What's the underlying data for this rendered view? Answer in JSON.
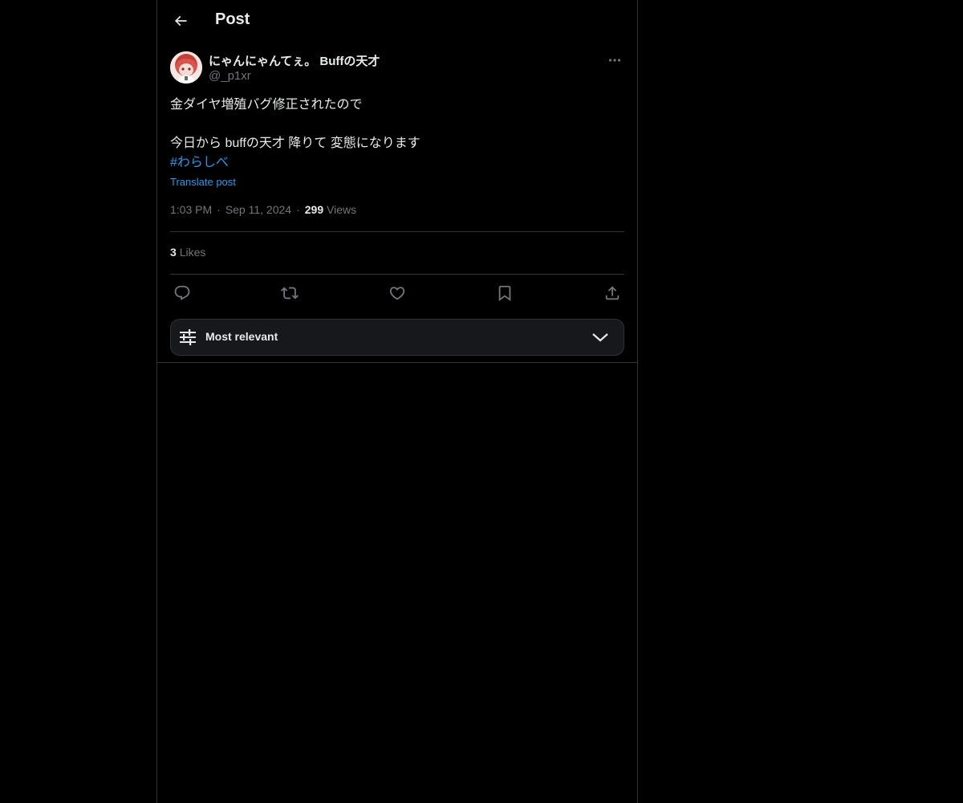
{
  "header": {
    "title": "Post"
  },
  "post": {
    "author": {
      "name": "にゃんにゃんてぇ。 Buffの天才",
      "handle": "@_p1xr"
    },
    "text_lines": [
      "金ダイヤ増殖バグ修正されたので",
      "今日から buffの天才 降りて 変態になります"
    ],
    "hashtag": "#わらしべ",
    "translate_label": "Translate post",
    "time": "1:03 PM",
    "date": "Sep 11, 2024",
    "views_count": "299",
    "views_label": "Views",
    "likes_count": "3",
    "likes_label": "Likes"
  },
  "actions": {
    "reply_icon": "reply-icon",
    "repost_icon": "repost-icon",
    "like_icon": "heart-icon",
    "bookmark_icon": "bookmark-icon",
    "share_icon": "share-icon"
  },
  "sort": {
    "label": "Most relevant"
  },
  "colors": {
    "background": "#000000",
    "text": "#e7e9ea",
    "muted": "#71767b",
    "accent": "#1d9bf0",
    "border": "#2f3336"
  }
}
